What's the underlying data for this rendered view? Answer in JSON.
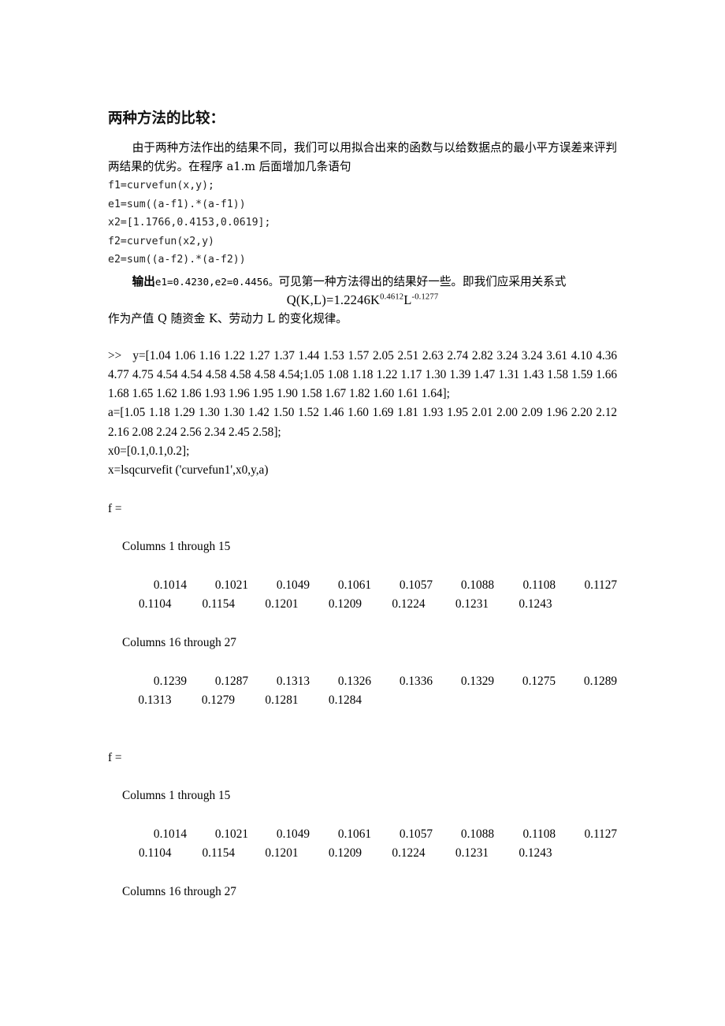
{
  "document": {
    "heading": "两种方法的比较：",
    "intro_paragraph": "由于两种方法作出的结果不同，我们可以用拟合出来的函数与以给数据点的最小平方误差来评判两结果的优劣。在程序 a1.m 后面增加几条语句",
    "code_lines": [
      "f1=curvefun(x,y);",
      "e1=sum((a-f1).*(a-f1))",
      "x2=[1.1766,0.4153,0.0619];",
      "f2=curvefun(x2,y)",
      "e2=sum((a-f2).*(a-f2))"
    ],
    "output_label": "输出",
    "output_values": "e1=0.4230,e2=0.4456。",
    "output_comment": "可见第一种方法得出的结果好一些。即我们应采用关系式",
    "formula": {
      "lead": "Q(K,L)=1.2246K",
      "exp1": "0.4612",
      "mid": "L",
      "exp2": "-0.1277"
    },
    "closing_paragraph": "作为产值 Q 随资金 K、劳动力 L 的变化规律。",
    "session": {
      "prompt_line": ">>   y=[1.04 1.06 1.16 1.22 1.27 1.37 1.44 1.53 1.57 2.05 2.51 2.63 2.74 2.82 3.24 3.24 3.61 4.10 4.36 4.77 4.75 4.54 4.54 4.58 4.58 4.58 4.54;1.05 1.08 1.18 1.22 1.17 1.30 1.39 1.47 1.31 1.43 1.58 1.59 1.66 1.68 1.65 1.62 1.86 1.93 1.96 1.95 1.90 1.58 1.67 1.82 1.60 1.61 1.64];",
      "a_line": "a=[1.05 1.18 1.29 1.30 1.30 1.42 1.50 1.52 1.46 1.60 1.69 1.81 1.93 1.95 2.01 2.00 2.09 1.96 2.20 2.12 2.16 2.08 2.24 2.56 2.34 2.45 2.58];",
      "x0_line": "x0=[0.1,0.1,0.2];",
      "lsq_line": "x=lsqcurvefit ('curvefun1',x0,y,a)",
      "f_label_1": "f =",
      "columns_header_1": "Columns 1 through 15",
      "block1_row1": [
        "0.1014",
        "0.1021",
        "0.1049",
        "0.1061",
        "0.1057",
        "0.1088",
        "0.1108",
        "0.1127"
      ],
      "block1_row2": [
        "0.1104",
        "0.1154",
        "0.1201",
        "0.1209",
        "0.1224",
        "0.1231",
        "0.1243"
      ],
      "columns_header_2": "Columns 16 through 27",
      "block2_row1": [
        "0.1239",
        "0.1287",
        "0.1313",
        "0.1326",
        "0.1336",
        "0.1329",
        "0.1275",
        "0.1289"
      ],
      "block2_row2": [
        "0.1313",
        "0.1279",
        "0.1281",
        "0.1284"
      ],
      "f_label_2": "f =",
      "columns_header_3": "Columns 1 through 15",
      "block3_row1": [
        "0.1014",
        "0.1021",
        "0.1049",
        "0.1061",
        "0.1057",
        "0.1088",
        "0.1108",
        "0.1127"
      ],
      "block3_row2": [
        "0.1104",
        "0.1154",
        "0.1201",
        "0.1209",
        "0.1224",
        "0.1231",
        "0.1243"
      ],
      "columns_header_4": "Columns 16 through 27"
    }
  }
}
